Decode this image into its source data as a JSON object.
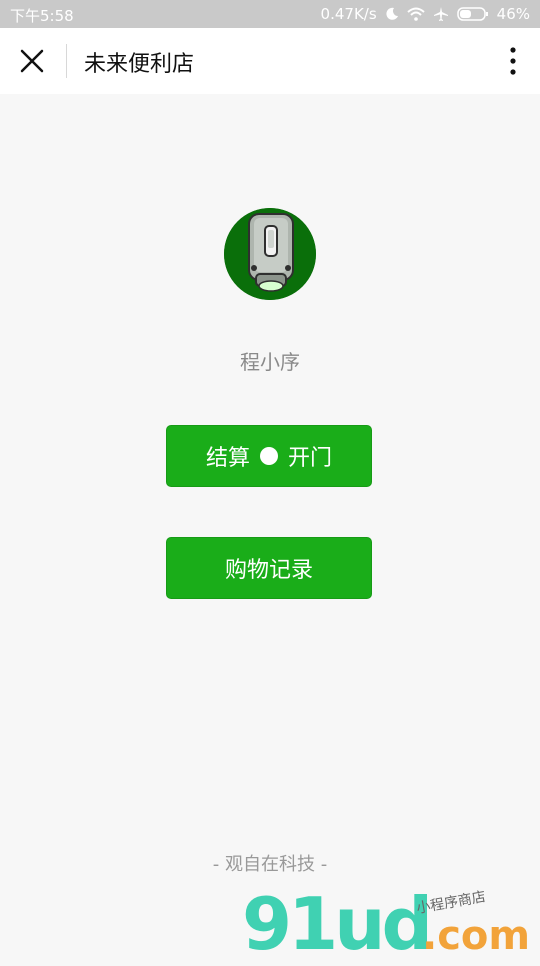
{
  "status_bar": {
    "time": "下午5:58",
    "network_speed": "0.47K/s",
    "battery": "46%",
    "icons": [
      "moon-icon",
      "wifi-icon",
      "airplane-icon",
      "battery-icon"
    ]
  },
  "nav": {
    "title": "未来便利店",
    "close_icon": "close-icon",
    "more_icon": "more-vertical-icon"
  },
  "profile": {
    "name": "程小序"
  },
  "buttons": {
    "checkout_left": "结算",
    "checkout_right": "开门",
    "records": "购物记录"
  },
  "footer": {
    "text": "- 观自在科技 -"
  },
  "watermark": {
    "logo": "91ud",
    "tagline": "小程序商店",
    "domain": ".com"
  },
  "colors": {
    "primary_green": "#1aad19",
    "avatar_bg": "#0a6f0a",
    "page_bg": "#f7f7f7"
  }
}
